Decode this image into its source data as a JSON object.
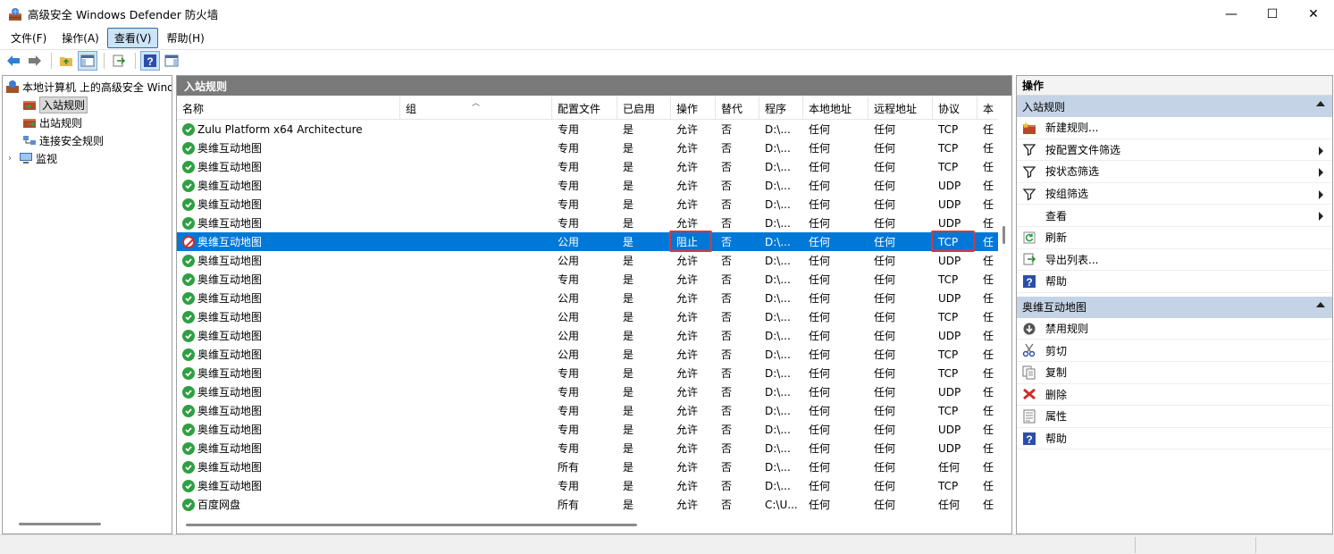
{
  "window": {
    "title": "高级安全 Windows Defender 防火墙",
    "minimize": "—",
    "maximize": "☐",
    "close": "✕"
  },
  "menu": [
    "文件(F)",
    "操作(A)",
    "查看(V)",
    "帮助(H)"
  ],
  "menu_active_index": 2,
  "toolbar_icons": [
    "back-arrow-icon",
    "forward-arrow-icon",
    "up-folder-icon",
    "show-hide-console-tree-icon",
    "export-list-icon",
    "help-icon",
    "show-hide-action-pane-icon"
  ],
  "tree": {
    "root": "本地计算机 上的高级安全 Windows Defender 防火墙",
    "items": [
      {
        "label": "入站规则",
        "icon": "inbound-rules-icon",
        "selected": true
      },
      {
        "label": "出站规则",
        "icon": "outbound-rules-icon",
        "selected": false
      },
      {
        "label": "连接安全规则",
        "icon": "connection-security-icon",
        "selected": false
      },
      {
        "label": "监视",
        "icon": "monitor-icon",
        "selected": false,
        "expandable": true
      }
    ]
  },
  "center": {
    "header": "入站规则",
    "columns": [
      "名称",
      "组",
      "配置文件",
      "已启用",
      "操作",
      "替代",
      "程序",
      "本地地址",
      "远程地址",
      "协议",
      "本"
    ],
    "rows": [
      {
        "status": "allow",
        "name": "Zulu Platform x64 Architecture",
        "group": "",
        "profile": "专用",
        "enabled": "是",
        "action": "允许",
        "override": "否",
        "program": "D:\\...",
        "local": "任何",
        "remote": "任何",
        "protocol": "TCP",
        "more": "任"
      },
      {
        "status": "allow",
        "name": "奥维互动地图",
        "group": "",
        "profile": "专用",
        "enabled": "是",
        "action": "允许",
        "override": "否",
        "program": "D:\\...",
        "local": "任何",
        "remote": "任何",
        "protocol": "TCP",
        "more": "任"
      },
      {
        "status": "allow",
        "name": "奥维互动地图",
        "group": "",
        "profile": "专用",
        "enabled": "是",
        "action": "允许",
        "override": "否",
        "program": "D:\\...",
        "local": "任何",
        "remote": "任何",
        "protocol": "TCP",
        "more": "任"
      },
      {
        "status": "allow",
        "name": "奥维互动地图",
        "group": "",
        "profile": "专用",
        "enabled": "是",
        "action": "允许",
        "override": "否",
        "program": "D:\\...",
        "local": "任何",
        "remote": "任何",
        "protocol": "UDP",
        "more": "任"
      },
      {
        "status": "allow",
        "name": "奥维互动地图",
        "group": "",
        "profile": "专用",
        "enabled": "是",
        "action": "允许",
        "override": "否",
        "program": "D:\\...",
        "local": "任何",
        "remote": "任何",
        "protocol": "UDP",
        "more": "任"
      },
      {
        "status": "allow",
        "name": "奥维互动地图",
        "group": "",
        "profile": "专用",
        "enabled": "是",
        "action": "允许",
        "override": "否",
        "program": "D:\\...",
        "local": "任何",
        "remote": "任何",
        "protocol": "UDP",
        "more": "任"
      },
      {
        "status": "block",
        "name": "奥维互动地图",
        "group": "",
        "profile": "公用",
        "enabled": "是",
        "action": "阻止",
        "override": "否",
        "program": "D:\\...",
        "local": "任何",
        "remote": "任何",
        "protocol": "TCP",
        "more": "任",
        "selected": true
      },
      {
        "status": "allow",
        "name": "奥维互动地图",
        "group": "",
        "profile": "公用",
        "enabled": "是",
        "action": "允许",
        "override": "否",
        "program": "D:\\...",
        "local": "任何",
        "remote": "任何",
        "protocol": "UDP",
        "more": "任"
      },
      {
        "status": "allow",
        "name": "奥维互动地图",
        "group": "",
        "profile": "专用",
        "enabled": "是",
        "action": "允许",
        "override": "否",
        "program": "D:\\...",
        "local": "任何",
        "remote": "任何",
        "protocol": "TCP",
        "more": "任"
      },
      {
        "status": "allow",
        "name": "奥维互动地图",
        "group": "",
        "profile": "公用",
        "enabled": "是",
        "action": "允许",
        "override": "否",
        "program": "D:\\...",
        "local": "任何",
        "remote": "任何",
        "protocol": "UDP",
        "more": "任"
      },
      {
        "status": "allow",
        "name": "奥维互动地图",
        "group": "",
        "profile": "公用",
        "enabled": "是",
        "action": "允许",
        "override": "否",
        "program": "D:\\...",
        "local": "任何",
        "remote": "任何",
        "protocol": "TCP",
        "more": "任"
      },
      {
        "status": "allow",
        "name": "奥维互动地图",
        "group": "",
        "profile": "公用",
        "enabled": "是",
        "action": "允许",
        "override": "否",
        "program": "D:\\...",
        "local": "任何",
        "remote": "任何",
        "protocol": "UDP",
        "more": "任"
      },
      {
        "status": "allow",
        "name": "奥维互动地图",
        "group": "",
        "profile": "公用",
        "enabled": "是",
        "action": "允许",
        "override": "否",
        "program": "D:\\...",
        "local": "任何",
        "remote": "任何",
        "protocol": "TCP",
        "more": "任"
      },
      {
        "status": "allow",
        "name": "奥维互动地图",
        "group": "",
        "profile": "专用",
        "enabled": "是",
        "action": "允许",
        "override": "否",
        "program": "D:\\...",
        "local": "任何",
        "remote": "任何",
        "protocol": "TCP",
        "more": "任"
      },
      {
        "status": "allow",
        "name": "奥维互动地图",
        "group": "",
        "profile": "专用",
        "enabled": "是",
        "action": "允许",
        "override": "否",
        "program": "D:\\...",
        "local": "任何",
        "remote": "任何",
        "protocol": "UDP",
        "more": "任"
      },
      {
        "status": "allow",
        "name": "奥维互动地图",
        "group": "",
        "profile": "专用",
        "enabled": "是",
        "action": "允许",
        "override": "否",
        "program": "D:\\...",
        "local": "任何",
        "remote": "任何",
        "protocol": "TCP",
        "more": "任"
      },
      {
        "status": "allow",
        "name": "奥维互动地图",
        "group": "",
        "profile": "专用",
        "enabled": "是",
        "action": "允许",
        "override": "否",
        "program": "D:\\...",
        "local": "任何",
        "remote": "任何",
        "protocol": "UDP",
        "more": "任"
      },
      {
        "status": "allow",
        "name": "奥维互动地图",
        "group": "",
        "profile": "专用",
        "enabled": "是",
        "action": "允许",
        "override": "否",
        "program": "D:\\...",
        "local": "任何",
        "remote": "任何",
        "protocol": "UDP",
        "more": "任"
      },
      {
        "status": "allow",
        "name": "奥维互动地图",
        "group": "",
        "profile": "所有",
        "enabled": "是",
        "action": "允许",
        "override": "否",
        "program": "D:\\...",
        "local": "任何",
        "remote": "任何",
        "protocol": "任何",
        "more": "任"
      },
      {
        "status": "allow",
        "name": "奥维互动地图",
        "group": "",
        "profile": "专用",
        "enabled": "是",
        "action": "允许",
        "override": "否",
        "program": "D:\\...",
        "local": "任何",
        "remote": "任何",
        "protocol": "TCP",
        "more": "任"
      },
      {
        "status": "allow",
        "name": "百度网盘",
        "group": "",
        "profile": "所有",
        "enabled": "是",
        "action": "允许",
        "override": "否",
        "program": "C:\\U...",
        "local": "任何",
        "remote": "任何",
        "protocol": "任何",
        "more": "任"
      }
    ]
  },
  "actions": {
    "title": "操作",
    "sections": [
      {
        "header": "入站规则",
        "items": [
          {
            "label": "新建规则...",
            "icon": "new-rule-icon",
            "submenu": false
          },
          {
            "label": "按配置文件筛选",
            "icon": "filter-icon",
            "submenu": true
          },
          {
            "label": "按状态筛选",
            "icon": "filter-icon",
            "submenu": true
          },
          {
            "label": "按组筛选",
            "icon": "filter-icon",
            "submenu": true
          },
          {
            "label": "查看",
            "icon": "",
            "submenu": true
          },
          {
            "label": "刷新",
            "icon": "refresh-icon",
            "submenu": false
          },
          {
            "label": "导出列表...",
            "icon": "export-list-icon",
            "submenu": false
          },
          {
            "label": "帮助",
            "icon": "help-icon",
            "submenu": false
          }
        ]
      },
      {
        "header": "奥维互动地图",
        "items": [
          {
            "label": "禁用规则",
            "icon": "disable-rule-icon",
            "submenu": false
          },
          {
            "label": "剪切",
            "icon": "cut-icon",
            "submenu": false
          },
          {
            "label": "复制",
            "icon": "copy-icon",
            "submenu": false
          },
          {
            "label": "删除",
            "icon": "delete-icon",
            "submenu": false
          },
          {
            "label": "属性",
            "icon": "properties-icon",
            "submenu": false
          },
          {
            "label": "帮助",
            "icon": "help-icon",
            "submenu": false
          }
        ]
      }
    ]
  },
  "colors": {
    "selection": "#0078d7",
    "allow": "#2ea043",
    "block": "#d12b2b",
    "highlight_box": "#e03434",
    "pane_header": "#7a7a7a",
    "action_section": "#c5d3e6"
  }
}
